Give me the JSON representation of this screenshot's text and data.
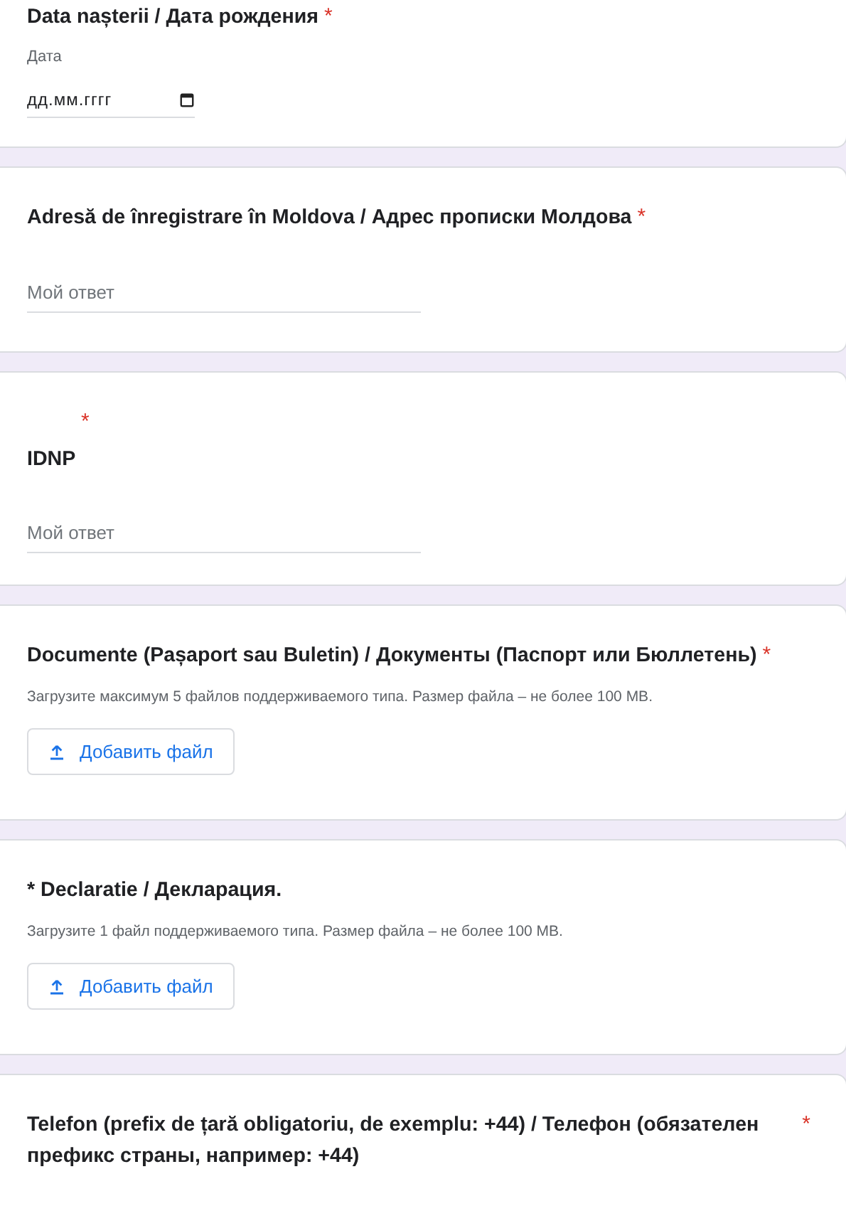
{
  "questions": [
    {
      "kind": "date",
      "title": "Data nașterii / Дата рождения",
      "asterisk": "*",
      "field_label": "Дата",
      "placeholder": "дд.мм.гггг"
    },
    {
      "kind": "text",
      "title": "Adresă de înregistrare în Moldova / Адрес прописки Молдова",
      "asterisk": "*",
      "placeholder": "Мой ответ"
    },
    {
      "kind": "text",
      "title": "IDNP",
      "asterisk_above": "*",
      "placeholder": "Мой ответ"
    },
    {
      "kind": "file",
      "title": "Documente (Pașaport sau Buletin) / Документы (Паспорт или Бюллетень)",
      "asterisk": "*",
      "hint": "Загрузите максимум 5 файлов поддерживаемого типа. Размер файла – не более 100 MB.",
      "button": "Добавить файл"
    },
    {
      "kind": "file",
      "title": "* Declaratie / Декларация.",
      "hint": "Загрузите 1 файл поддерживаемого типа. Размер файла – не более 100 MB.",
      "button": "Добавить файл"
    },
    {
      "kind": "text_cut",
      "title": "Telefon (prefix de țară obligatoriu, de exemplu: +44) / Телефон (обязателен префикс страны, например: +44)",
      "asterisk_right": "*"
    }
  ]
}
